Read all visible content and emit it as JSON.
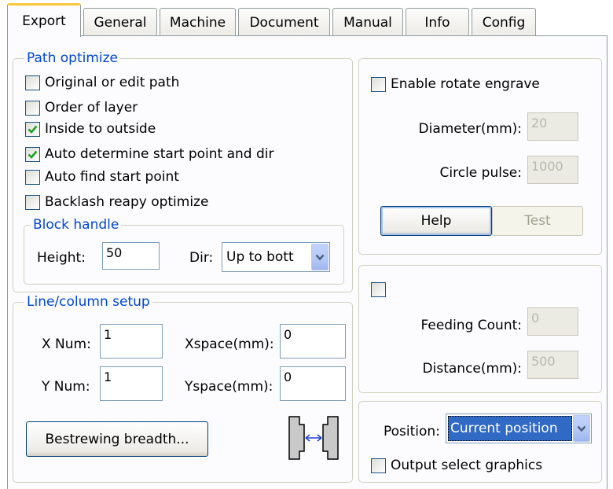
{
  "tabs": [
    "Export",
    "General",
    "Machine",
    "Document",
    "Manual",
    "Info",
    "Config"
  ],
  "path_optimize": {
    "title": "Path optimize",
    "options": [
      {
        "label": "Original or edit path",
        "checked": false
      },
      {
        "label": "Order of layer",
        "checked": false
      },
      {
        "label": "Inside to outside",
        "checked": true
      },
      {
        "label": "Auto determine start point and dir",
        "checked": true
      },
      {
        "label": "Auto find start point",
        "checked": false
      },
      {
        "label": "Backlash reapy optimize",
        "checked": false
      }
    ]
  },
  "block_handle": {
    "title": "Block handle",
    "height_label": "Height:",
    "height_value": "50",
    "dir_label": "Dir:",
    "dir_value": "Up to bott"
  },
  "line_column": {
    "title": "Line/column setup",
    "x_num_label": "X Num:",
    "x_num_value": "1",
    "y_num_label": "Y Num:",
    "y_num_value": "1",
    "xspace_label": "Xspace(mm):",
    "xspace_value": "0",
    "yspace_label": "Yspace(mm):",
    "yspace_value": "0",
    "bestrewing_button": "Bestrewing breadth..."
  },
  "rotate": {
    "enable_label": "Enable rotate engrave",
    "enabled": false,
    "diameter_label": "Diameter(mm):",
    "diameter_value": "20",
    "circle_pulse_label": "Circle pulse:",
    "circle_pulse_value": "1000",
    "help_button": "Help",
    "test_button": "Test"
  },
  "feeding": {
    "enabled": false,
    "feeding_count_label": "Feeding Count:",
    "feeding_count_value": "0",
    "distance_label": "Distance(mm):",
    "distance_value": "500"
  },
  "position": {
    "label": "Position:",
    "value": "Current position",
    "output_select_label": "Output select graphics",
    "output_select_checked": false
  },
  "icons": {
    "checkmark": "checkmark-icon",
    "dropdown": "chevron-down-icon",
    "spacing": "spacing-arrow-icon"
  },
  "colors": {
    "group_title": "#0046d5",
    "active_tab_highlight": "#ffc83c",
    "check_green": "#21a121",
    "selection": "#316ac5"
  }
}
